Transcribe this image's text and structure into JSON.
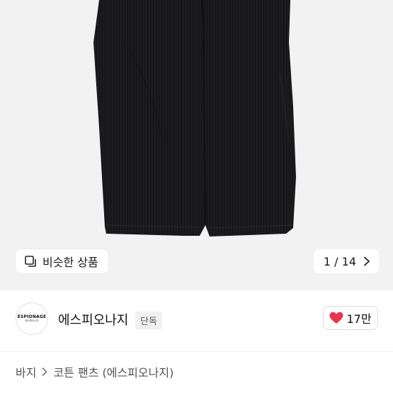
{
  "gallery": {
    "similar_label": "비슷한 상품",
    "counter": "1 / 14"
  },
  "shop": {
    "logo_text": "ESPIONAGE",
    "logo_subtext": "에스피오나지",
    "name": "에스피오나지",
    "badge": "단독",
    "like_count": "17만"
  },
  "breadcrumb": {
    "items": [
      "바지",
      "코튼 팬츠 (에스피오나지)"
    ]
  },
  "colors": {
    "heart": "#e8344e",
    "hero_bg": "#f2f2f2",
    "product": "#1b1b1c"
  }
}
